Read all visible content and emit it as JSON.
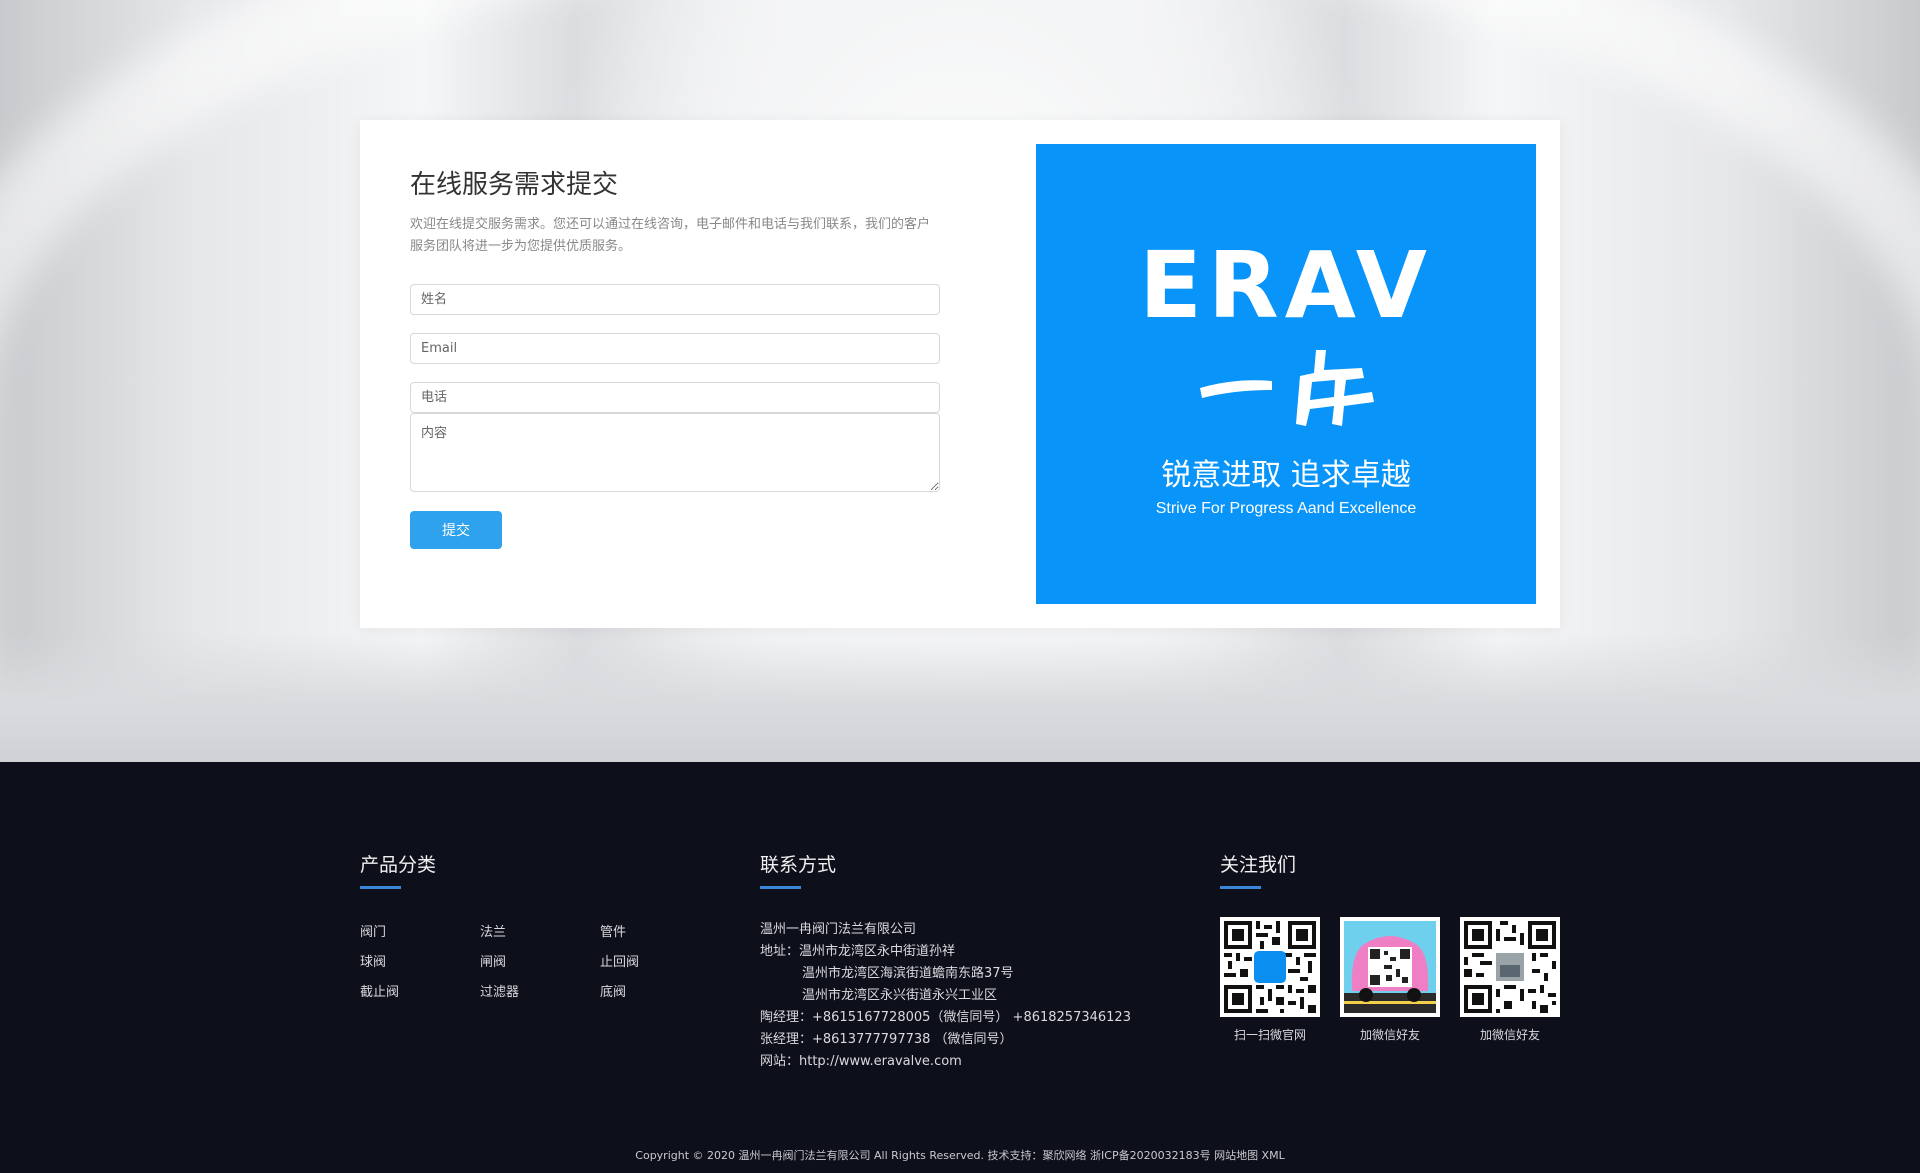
{
  "form": {
    "title": "在线服务需求提交",
    "description": "欢迎在线提交服务需求。您还可以通过在线咨询，电子邮件和电话与我们联系，我们的客户服务团队将进一步为您提供优质服务。",
    "name_placeholder": "姓名",
    "email_placeholder": "Email",
    "phone_placeholder": "电话",
    "content_placeholder": "内容",
    "submit_label": "提交"
  },
  "brand": {
    "logo_text": "ERAV",
    "logo_chinese": "一冉",
    "slogan": "锐意进取 追求卓越",
    "slogan_en": "Strive For Progress Aand Excellence",
    "background_color": "#0894f8"
  },
  "footer": {
    "products": {
      "heading": "产品分类",
      "items": [
        "阀门",
        "法兰",
        "管件",
        "球阀",
        "闸阀",
        "止回阀",
        "截止阀",
        "过滤器",
        "底阀"
      ]
    },
    "contact": {
      "heading": "联系方式",
      "company": "温州一冉阀门法兰有限公司",
      "address_line1": "地址：温州市龙湾区永中街道孙祥",
      "address_line2": "温州市龙湾区海滨街道蟾南东路37号",
      "address_line3": "温州市龙湾区永兴街道永兴工业区",
      "manager_tao": "陶经理：+8615167728005（微信同号） +8618257346123",
      "manager_zhang": "张经理：+8613777797738 （微信同号）",
      "website": "网站：http://www.eravalve.com"
    },
    "follow": {
      "heading": "关注我们",
      "qr_codes": [
        {
          "caption": "扫一扫微官网"
        },
        {
          "caption": "加微信好友"
        },
        {
          "caption": "加微信好友"
        }
      ],
      "qr_badge": "ERAV"
    },
    "copyright": "Copyright © 2020 温州一冉阀门法兰有限公司 All Rights Reserved. 技术支持：聚欣网络 浙ICP备2020032183号 网站地图 XML"
  },
  "colors": {
    "accent": "#2ea2ec",
    "footer_bg": "#0d0f1a",
    "heading_underline": "#3a86d8"
  }
}
